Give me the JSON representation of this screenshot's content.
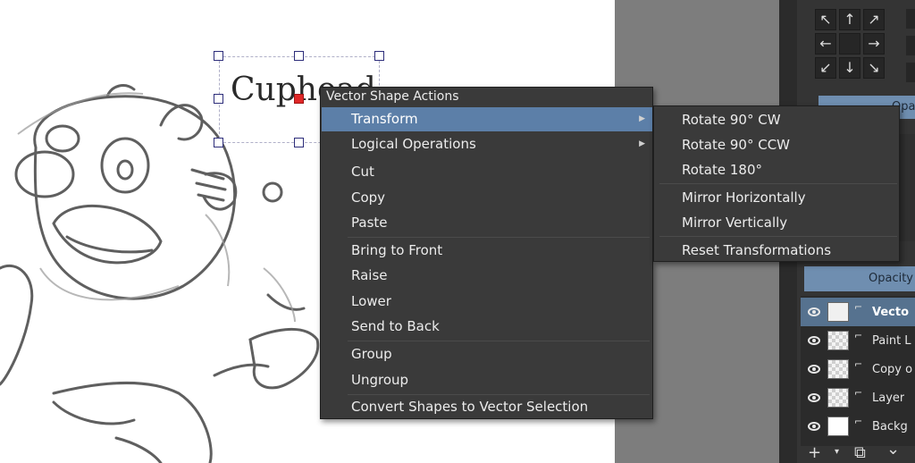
{
  "canvas": {
    "vector_text": "Cuphead"
  },
  "context_menu": {
    "title": "Vector Shape Actions",
    "items": [
      {
        "label": "Transform",
        "has_submenu": true
      },
      {
        "label": "Logical Operations",
        "has_submenu": true
      },
      {
        "label": "Cut"
      },
      {
        "label": "Copy"
      },
      {
        "label": "Paste"
      },
      {
        "label": "Bring to Front"
      },
      {
        "label": "Raise"
      },
      {
        "label": "Lower"
      },
      {
        "label": "Send to Back"
      },
      {
        "label": "Group"
      },
      {
        "label": "Ungroup"
      },
      {
        "label": "Convert Shapes to Vector Selection"
      }
    ]
  },
  "transform_submenu": {
    "items": [
      {
        "label": "Rotate 90° CW"
      },
      {
        "label": "Rotate 90° CCW"
      },
      {
        "label": "Rotate 180°"
      },
      {
        "label": "Mirror Horizontally"
      },
      {
        "label": "Mirror Vertically"
      },
      {
        "label": "Reset Transformations"
      }
    ]
  },
  "docker": {
    "opacity_top_label": "Opa",
    "opacity_label": "Opacity",
    "arrow_buttons": [
      "↖",
      "↑",
      "↗",
      "←",
      "",
      "→",
      "↙",
      "↓",
      "↘"
    ],
    "layers": [
      {
        "name": "Vecto",
        "thumb": "vector",
        "selected": true
      },
      {
        "name": "Paint L",
        "thumb": "checker"
      },
      {
        "name": "Copy o",
        "thumb": "checker"
      },
      {
        "name": "Layer",
        "thumb": "checker"
      },
      {
        "name": "Backg",
        "thumb": "white"
      }
    ],
    "bottom_tools": [
      "+",
      "▾",
      "⧉",
      "⌄"
    ]
  },
  "colors": {
    "menu_bg": "#3a3a3a",
    "highlight": "#5c7fa8",
    "docker_bg": "#343434",
    "opacity_bar": "#6f8eb0"
  }
}
